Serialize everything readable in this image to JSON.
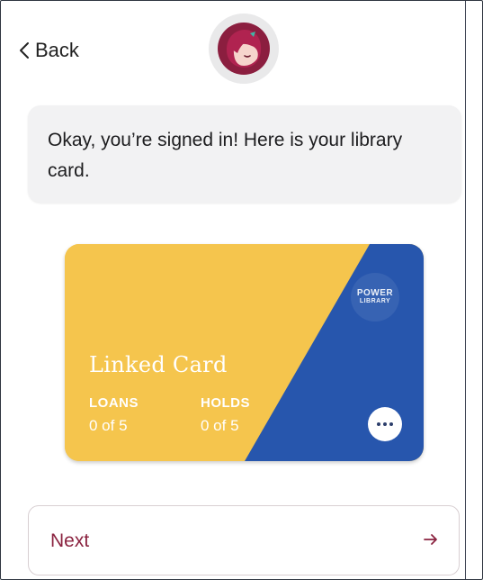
{
  "header": {
    "back_label": "Back",
    "back_icon": "chevron-left-icon",
    "avatar_icon": "libby-avatar-icon"
  },
  "message": {
    "text": "Okay, you’re signed in! Here is your library card."
  },
  "card": {
    "title": "Linked Card",
    "logo_line1": "POWER",
    "logo_line2": "LIBRARY",
    "loans_label": "LOANS",
    "loans_value": "0 of 5",
    "holds_label": "HOLDS",
    "holds_value": "0 of 5",
    "more_icon": "more-dots-icon",
    "colors": {
      "yellow": "#f5c54d",
      "blue": "#2756ad"
    }
  },
  "next": {
    "label": "Next",
    "arrow_icon": "arrow-right-icon",
    "color": "#8b2340"
  }
}
